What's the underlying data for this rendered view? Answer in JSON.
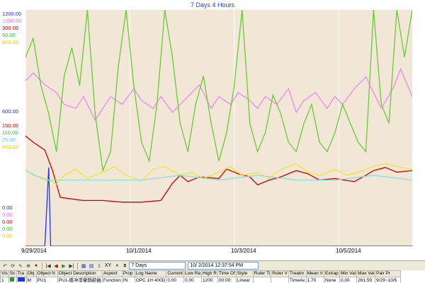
{
  "title": "7 Days 4 Hours",
  "scale_labels": [
    {
      "text": "1200.00",
      "color": "#1a33ff"
    },
    {
      "text": "1200.00",
      "color": "#ff66ff"
    },
    {
      "text": "300.00",
      "color": "#cc0000"
    },
    {
      "text": "50.00",
      "color": "#22cc22"
    },
    {
      "text": "800.00",
      "color": "#e6d600"
    },
    {
      "text": "600.00",
      "color": "#1a33ff"
    },
    {
      "text": "150.00",
      "color": "#cc0000"
    },
    {
      "text": "110.00",
      "color": "#22cc22"
    },
    {
      "text": "25.00",
      "color": "#44dddd"
    },
    {
      "text": "400.00",
      "color": "#e6d600"
    },
    {
      "text": "0.00",
      "color": "#1a33ff"
    },
    {
      "text": "0.00",
      "color": "#ff66ff"
    },
    {
      "text": "0.00",
      "color": "#cc0000"
    },
    {
      "text": "0.00",
      "color": "#22cc22"
    },
    {
      "text": "0.00",
      "color": "#e6d600"
    }
  ],
  "dates": [
    "9/29/2014",
    "10/1/2014",
    "10/3/2014",
    "10/5/2014"
  ],
  "toolbar": {
    "xy_label": "XY",
    "range_value": "7 Days",
    "datetime_value": "10/ 2/2014 12:37:54 PM"
  },
  "table": {
    "headers": [
      "Vis",
      "Sc",
      "Tra",
      "Obj",
      "Object N",
      "Object Description",
      "Aspect",
      "Prop",
      "Log Name",
      "Current",
      "Low Ra",
      "High R",
      "Time Of",
      "Style",
      "Ruler Ti",
      "Ruler V",
      "Treatm",
      "Mean V",
      "Extrap",
      "Min Val",
      "Max Val",
      "Pair Pr"
    ],
    "row": [
      "1",
      "",
      "",
      "M",
      "PU1",
      "PU1-緩冲漆彙鍋蔚曲",
      "Function",
      "IN",
      "OPC 1H 400D",
      "0.00",
      "0.00",
      "1200",
      "00:00:",
      "Linear",
      "",
      "",
      "TimeAv",
      "1.70",
      "None",
      "0.00",
      "261.59",
      "9/29~10/5"
    ]
  },
  "chart_data": {
    "type": "line",
    "x_range": [
      "2014-09-28",
      "2014-10-06"
    ],
    "x_tick_labels": [
      "9/29/2014",
      "10/1/2014",
      "10/3/2014",
      "10/5/2014"
    ],
    "series": [
      {
        "color": "#1a33ff",
        "ylim": [
          0,
          1200
        ],
        "points": [
          [
            0,
            0
          ],
          [
            0.05,
            0
          ],
          [
            0.06,
            400
          ],
          [
            0.065,
            0
          ],
          [
            1,
            0
          ]
        ]
      },
      {
        "color": "#ee88ee",
        "ylim": [
          0,
          1200
        ],
        "points": [
          [
            0,
            840
          ],
          [
            0.02,
            880
          ],
          [
            0.05,
            820
          ],
          [
            0.08,
            780
          ],
          [
            0.1,
            720
          ],
          [
            0.13,
            700
          ],
          [
            0.15,
            760
          ],
          [
            0.18,
            640
          ],
          [
            0.2,
            700
          ],
          [
            0.22,
            760
          ],
          [
            0.25,
            720
          ],
          [
            0.28,
            800
          ],
          [
            0.3,
            740
          ],
          [
            0.33,
            700
          ],
          [
            0.35,
            760
          ],
          [
            0.38,
            680
          ],
          [
            0.4,
            720
          ],
          [
            0.42,
            760
          ],
          [
            0.45,
            820
          ],
          [
            0.48,
            700
          ],
          [
            0.5,
            760
          ],
          [
            0.53,
            720
          ],
          [
            0.55,
            780
          ],
          [
            0.58,
            740
          ],
          [
            0.6,
            700
          ],
          [
            0.62,
            760
          ],
          [
            0.65,
            720
          ],
          [
            0.68,
            800
          ],
          [
            0.7,
            680
          ],
          [
            0.72,
            740
          ],
          [
            0.75,
            780
          ],
          [
            0.78,
            700
          ],
          [
            0.8,
            760
          ],
          [
            0.82,
            720
          ],
          [
            0.85,
            800
          ],
          [
            0.88,
            860
          ],
          [
            0.9,
            780
          ],
          [
            0.92,
            700
          ],
          [
            0.95,
            800
          ],
          [
            0.97,
            900
          ],
          [
            1,
            760
          ]
        ]
      },
      {
        "color": "#cc0000",
        "ylim": [
          0,
          300
        ],
        "points": [
          [
            0,
            140
          ],
          [
            0.02,
            132
          ],
          [
            0.05,
            122
          ],
          [
            0.07,
            96
          ],
          [
            0.09,
            62
          ],
          [
            0.12,
            60
          ],
          [
            0.15,
            58
          ],
          [
            0.2,
            58
          ],
          [
            0.25,
            56
          ],
          [
            0.3,
            56
          ],
          [
            0.35,
            58
          ],
          [
            0.38,
            80
          ],
          [
            0.4,
            90
          ],
          [
            0.42,
            82
          ],
          [
            0.45,
            88
          ],
          [
            0.5,
            86
          ],
          [
            0.52,
            98
          ],
          [
            0.55,
            92
          ],
          [
            0.58,
            88
          ],
          [
            0.6,
            78
          ],
          [
            0.63,
            84
          ],
          [
            0.66,
            88
          ],
          [
            0.7,
            96
          ],
          [
            0.73,
            92
          ],
          [
            0.76,
            84
          ],
          [
            0.8,
            86
          ],
          [
            0.85,
            82
          ],
          [
            0.88,
            90
          ],
          [
            0.9,
            96
          ],
          [
            0.93,
            100
          ],
          [
            0.96,
            94
          ],
          [
            1,
            96
          ]
        ]
      },
      {
        "color": "#66cc33",
        "ylim": [
          0,
          50
        ],
        "points": [
          [
            0,
            40
          ],
          [
            0.02,
            44
          ],
          [
            0.04,
            34
          ],
          [
            0.06,
            28
          ],
          [
            0.08,
            20
          ],
          [
            0.1,
            36
          ],
          [
            0.12,
            42
          ],
          [
            0.14,
            34
          ],
          [
            0.16,
            50
          ],
          [
            0.18,
            28
          ],
          [
            0.2,
            16
          ],
          [
            0.22,
            20
          ],
          [
            0.24,
            38
          ],
          [
            0.26,
            50
          ],
          [
            0.28,
            34
          ],
          [
            0.3,
            22
          ],
          [
            0.32,
            18
          ],
          [
            0.34,
            30
          ],
          [
            0.36,
            50
          ],
          [
            0.38,
            40
          ],
          [
            0.4,
            26
          ],
          [
            0.42,
            20
          ],
          [
            0.44,
            30
          ],
          [
            0.46,
            36
          ],
          [
            0.48,
            26
          ],
          [
            0.5,
            18
          ],
          [
            0.52,
            24
          ],
          [
            0.54,
            34
          ],
          [
            0.56,
            50
          ],
          [
            0.58,
            26
          ],
          [
            0.6,
            20
          ],
          [
            0.62,
            24
          ],
          [
            0.64,
            32
          ],
          [
            0.66,
            28
          ],
          [
            0.68,
            22
          ],
          [
            0.7,
            20
          ],
          [
            0.72,
            26
          ],
          [
            0.74,
            30
          ],
          [
            0.76,
            22
          ],
          [
            0.78,
            20
          ],
          [
            0.8,
            24
          ],
          [
            0.82,
            30
          ],
          [
            0.84,
            26
          ],
          [
            0.86,
            22
          ],
          [
            0.88,
            20
          ],
          [
            0.9,
            50
          ],
          [
            0.92,
            30
          ],
          [
            0.94,
            26
          ],
          [
            0.96,
            50
          ],
          [
            0.98,
            40
          ],
          [
            1,
            50
          ]
        ]
      },
      {
        "color": "#f0e630",
        "ylim": [
          0,
          800
        ],
        "points": [
          [
            0,
            260
          ],
          [
            0.02,
            240
          ],
          [
            0.05,
            230
          ],
          [
            0.08,
            210
          ],
          [
            0.1,
            240
          ],
          [
            0.13,
            260
          ],
          [
            0.16,
            230
          ],
          [
            0.2,
            250
          ],
          [
            0.23,
            270
          ],
          [
            0.26,
            240
          ],
          [
            0.3,
            220
          ],
          [
            0.33,
            260
          ],
          [
            0.36,
            270
          ],
          [
            0.4,
            240
          ],
          [
            0.43,
            250
          ],
          [
            0.46,
            230
          ],
          [
            0.5,
            250
          ],
          [
            0.53,
            270
          ],
          [
            0.56,
            240
          ],
          [
            0.6,
            250
          ],
          [
            0.63,
            230
          ],
          [
            0.66,
            260
          ],
          [
            0.7,
            280
          ],
          [
            0.73,
            250
          ],
          [
            0.76,
            240
          ],
          [
            0.8,
            260
          ],
          [
            0.83,
            240
          ],
          [
            0.86,
            250
          ],
          [
            0.9,
            270
          ],
          [
            0.93,
            280
          ],
          [
            0.96,
            270
          ],
          [
            1,
            260
          ]
        ]
      },
      {
        "color": "#88e0e0",
        "ylim": [
          0,
          25
        ],
        "points": [
          [
            0,
            8
          ],
          [
            0.05,
            7
          ],
          [
            0.1,
            7
          ],
          [
            0.2,
            7
          ],
          [
            0.3,
            7
          ],
          [
            0.4,
            7.5
          ],
          [
            0.5,
            7
          ],
          [
            0.6,
            7.5
          ],
          [
            0.7,
            7
          ],
          [
            0.8,
            7
          ],
          [
            0.9,
            7.5
          ],
          [
            1,
            7
          ]
        ]
      }
    ]
  }
}
